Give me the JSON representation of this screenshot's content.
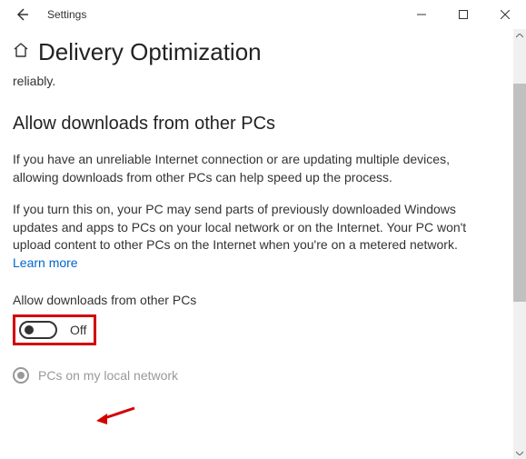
{
  "titlebar": {
    "app_title": "Settings"
  },
  "header": {
    "title": "Delivery Optimization"
  },
  "fragment": "reliably.",
  "section": {
    "heading": "Allow downloads from other PCs",
    "para1": "If you have an unreliable Internet connection or are updating multiple devices, allowing downloads from other PCs can help speed up the process.",
    "para2": "If you turn this on, your PC may send parts of previously downloaded Windows updates and apps to PCs on your local network or on the Internet. Your PC won't upload content to other PCs on the Internet when you're on a metered network.",
    "learn_more": "Learn more",
    "toggle_heading": "Allow downloads from other PCs",
    "toggle_state": "Off",
    "radio1": "PCs on my local network"
  }
}
